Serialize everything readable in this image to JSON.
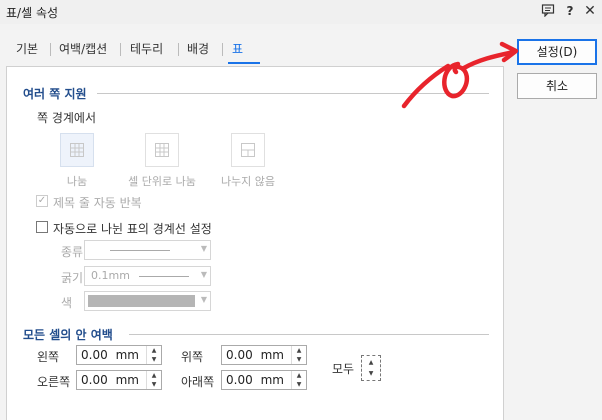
{
  "window": {
    "title": "표/셀 속성",
    "icons": [
      "comment-icon",
      "help-icon",
      "close-icon"
    ]
  },
  "tabs": [
    {
      "label": "기본",
      "active": false
    },
    {
      "label": "여백/캡션",
      "active": false
    },
    {
      "label": "테두리",
      "active": false
    },
    {
      "label": "배경",
      "active": false
    },
    {
      "label": "표",
      "active": true
    }
  ],
  "multi_page": {
    "title": "여러 쪽 지원",
    "boundary_label": "쪽 경계에서",
    "options": [
      {
        "label": "나눔",
        "selected": true
      },
      {
        "label": "셀 단위로 나눔",
        "selected": false
      },
      {
        "label": "나누지 않음",
        "selected": false
      }
    ],
    "repeat_header": {
      "label": "제목 줄 자동 반복",
      "checked": true,
      "enabled": false
    },
    "auto_split_border": {
      "label": "자동으로 나뉜 표의 경계선 설정",
      "checked": false,
      "enabled": true
    },
    "type_label": "종류",
    "thickness_label": "굵기",
    "thickness_value": "0.1mm",
    "color_label": "색"
  },
  "cell_margin": {
    "title": "모든 셀의 안 여백",
    "left": {
      "label": "왼쪽",
      "value": "0.00",
      "unit": "mm"
    },
    "right": {
      "label": "오른쪽",
      "value": "0.00",
      "unit": "mm"
    },
    "top": {
      "label": "위쪽",
      "value": "0.00",
      "unit": "mm"
    },
    "bottom": {
      "label": "아래쪽",
      "value": "0.00",
      "unit": "mm"
    },
    "all_label": "모두"
  },
  "buttons": {
    "ok": "설정(D)",
    "cancel": "취소"
  },
  "colors": {
    "accent": "#1a73e8",
    "section_title": "#224d8c",
    "annotation_red": "#e8242c"
  }
}
